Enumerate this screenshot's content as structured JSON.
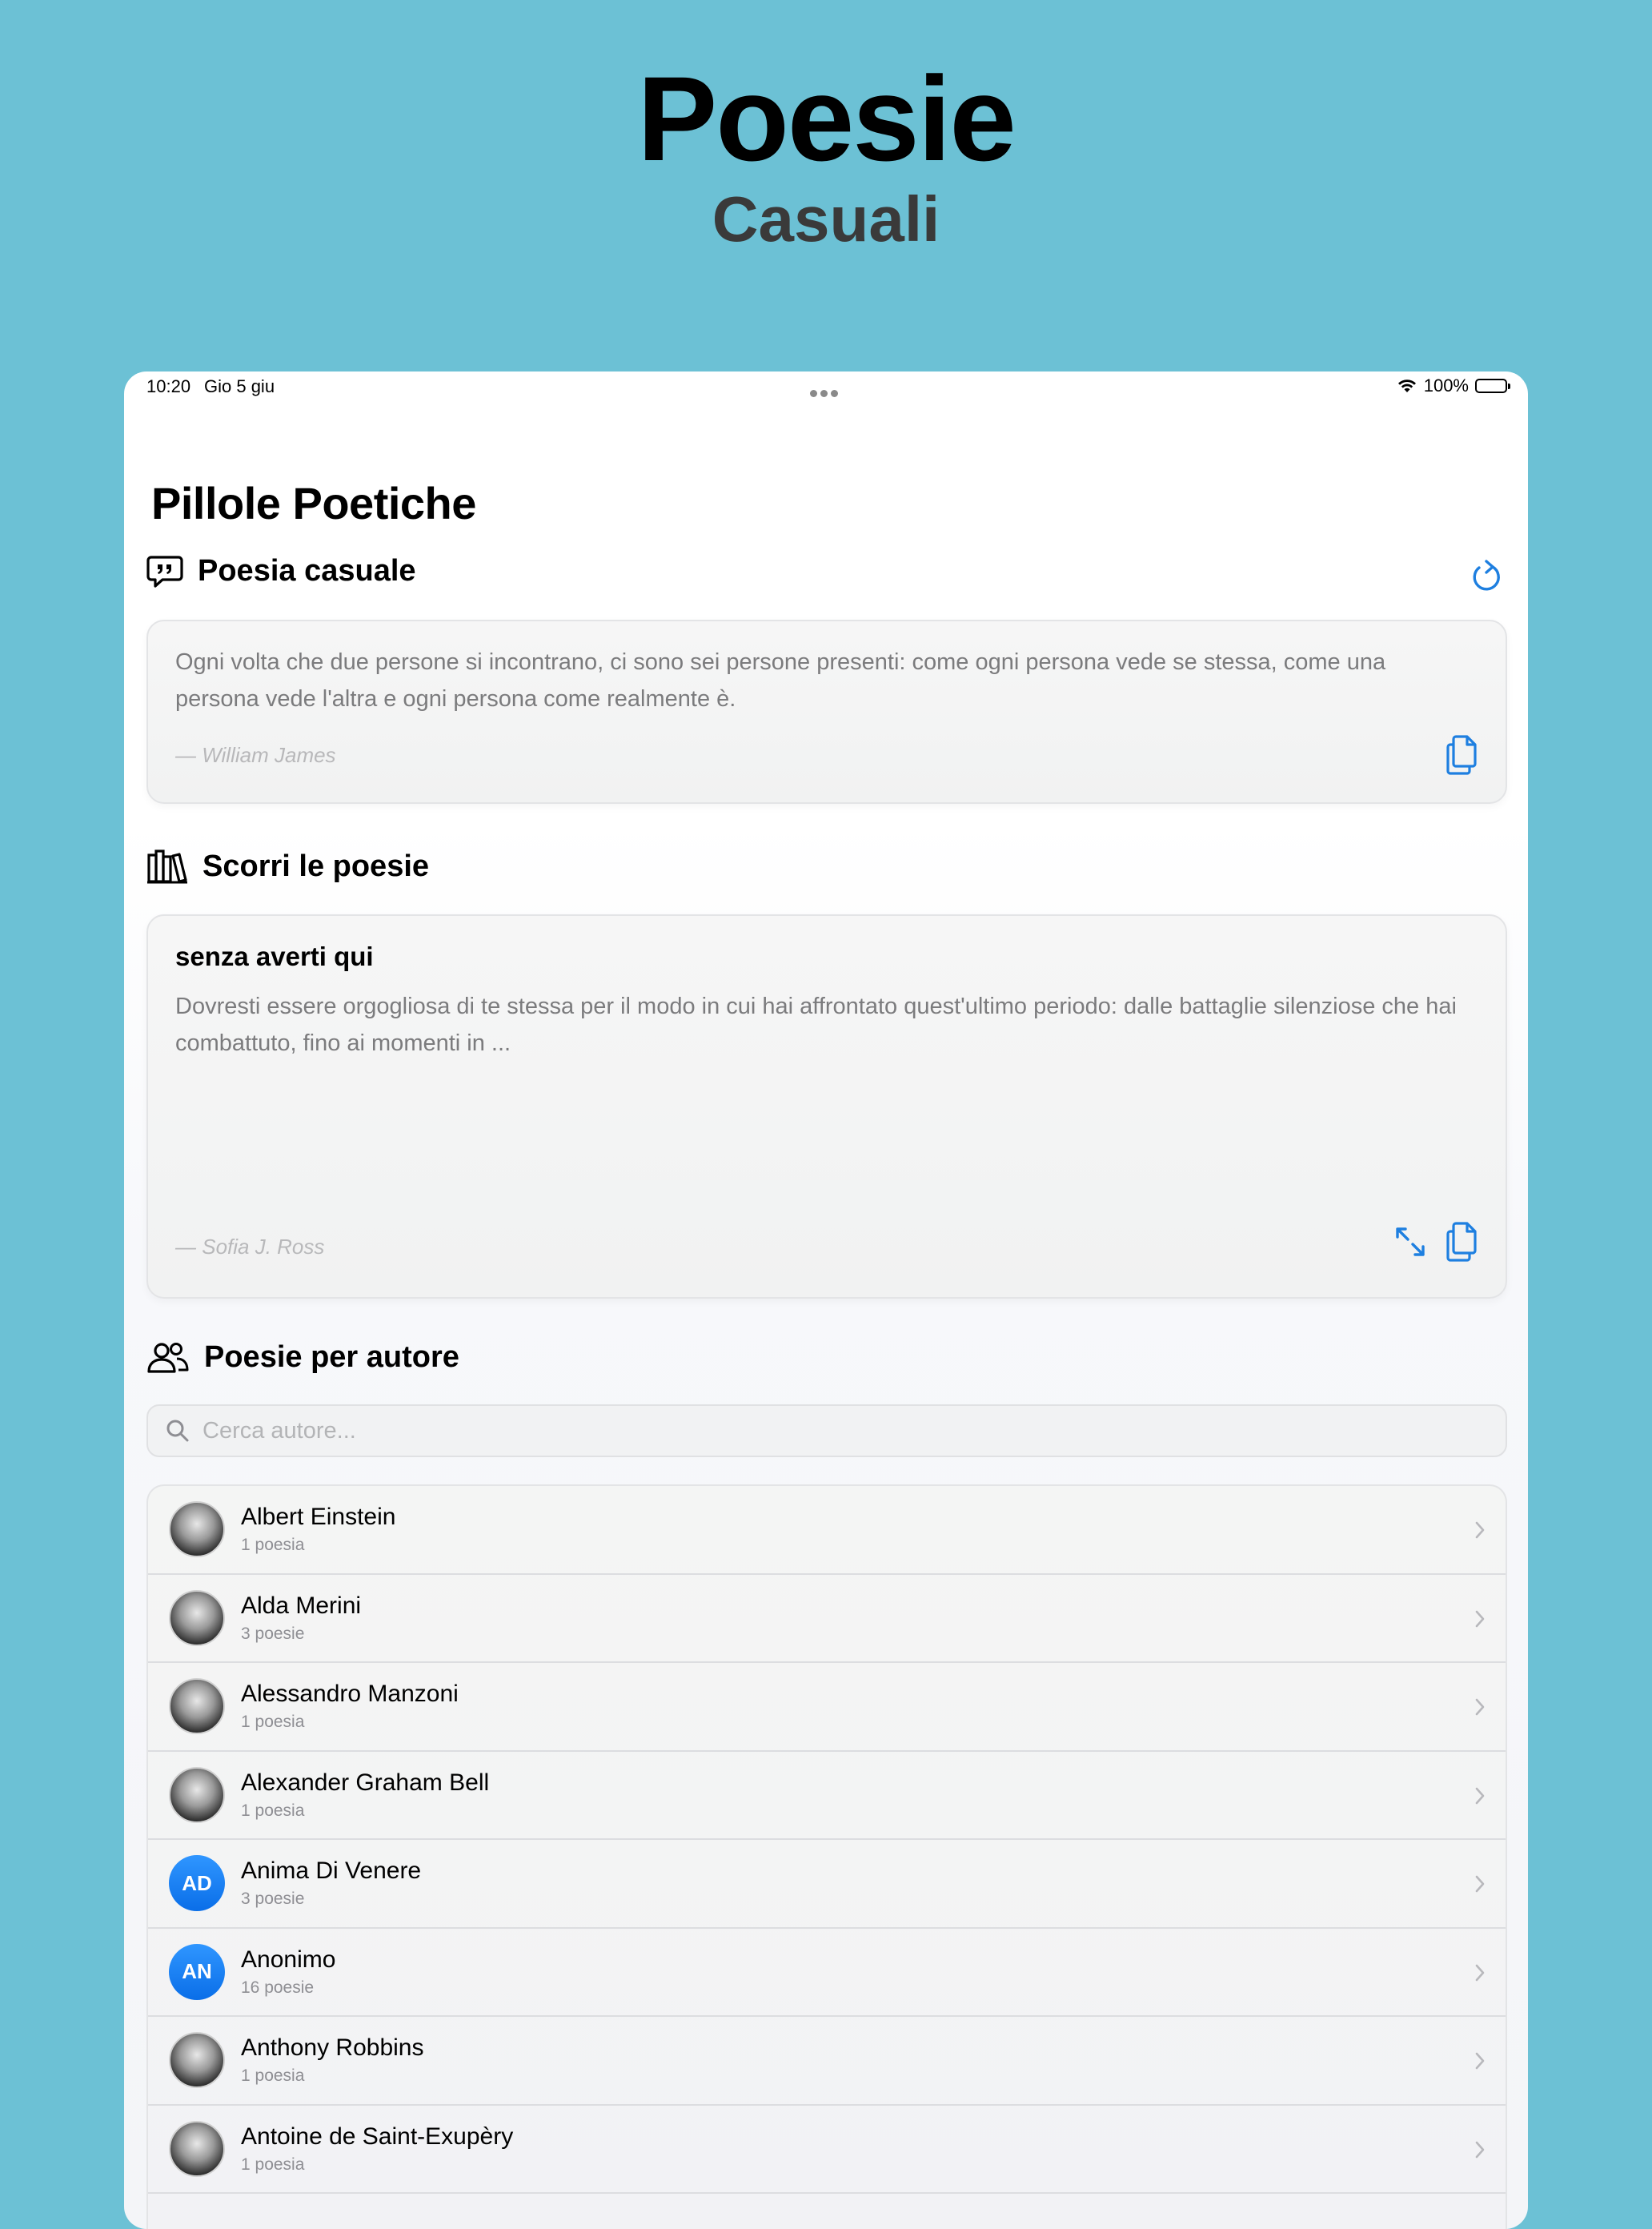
{
  "promo": {
    "title": "Poesie",
    "subtitle": "Casuali"
  },
  "status_bar": {
    "time": "10:20",
    "date": "Gio 5 giu",
    "battery": "100%"
  },
  "app": {
    "title": "Pillole Poetiche"
  },
  "random_section": {
    "title": "Poesia casuale",
    "quote": "Ogni volta che due persone si incontrano, ci sono sei persone presenti: come ogni persona vede se stessa, come una persona vede l'altra e ogni persona come realmente è.",
    "author": "— William James",
    "icons": [
      "chat-quote-icon",
      "refresh-icon",
      "copy-icon"
    ]
  },
  "browse_section": {
    "title": "Scorri le poesie",
    "poem_title": "senza averti qui",
    "excerpt": "Dovresti essere orgogliosa di te stessa per il modo in cui hai affrontato quest'ultimo periodo: dalle battaglie silenziose che hai combattuto, fino ai momenti in ...",
    "author": "— Sofia J. Ross",
    "icons": [
      "books-icon",
      "expand-icon",
      "copy-icon"
    ]
  },
  "authors_section": {
    "title": "Poesie per autore",
    "search_placeholder": "Cerca autore...",
    "authors": [
      {
        "name": "Albert Einstein",
        "count": "1 poesia",
        "avatar": "photo"
      },
      {
        "name": "Alda Merini",
        "count": "3 poesie",
        "avatar": "photo"
      },
      {
        "name": "Alessandro Manzoni",
        "count": "1 poesia",
        "avatar": "photo"
      },
      {
        "name": "Alexander Graham Bell",
        "count": "1 poesia",
        "avatar": "photo"
      },
      {
        "name": "Anima Di Venere",
        "count": "3 poesie",
        "avatar": "AD"
      },
      {
        "name": "Anonimo",
        "count": "16 poesie",
        "avatar": "AN"
      },
      {
        "name": "Anthony Robbins",
        "count": "1 poesia",
        "avatar": "photo"
      },
      {
        "name": "Antoine de Saint-Exupèry",
        "count": "1 poesia",
        "avatar": "photo"
      }
    ]
  },
  "colors": {
    "accent": "#1E7FE0",
    "background": "#6CC1D5"
  }
}
